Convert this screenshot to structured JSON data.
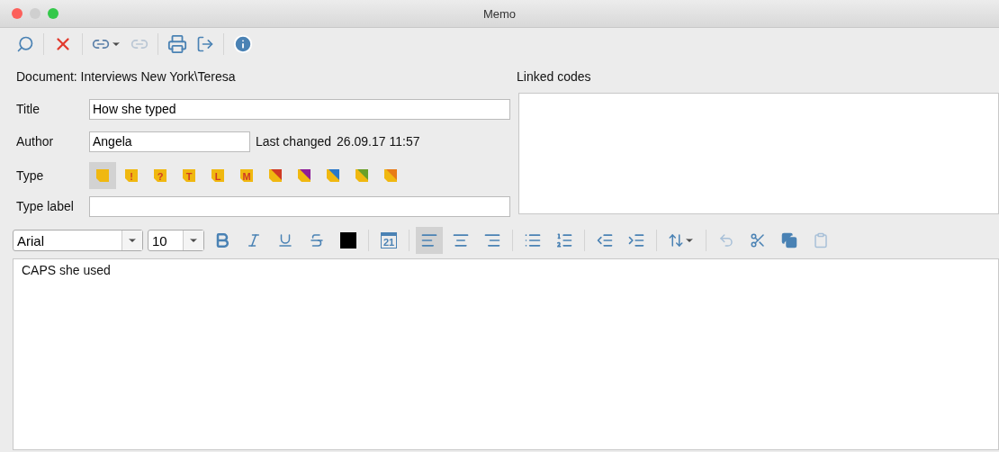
{
  "window": {
    "title": "Memo"
  },
  "document": {
    "label": "Document:",
    "value": "Interviews New York\\Teresa"
  },
  "linked_codes": {
    "label": "Linked codes"
  },
  "fields": {
    "title_label": "Title",
    "title_value": "How she typed",
    "author_label": "Author",
    "author_value": "Angela",
    "last_changed_label": "Last changed",
    "last_changed_value": "26.09.17 11:57",
    "type_label": "Type",
    "type_label_label": "Type label"
  },
  "types": [
    {
      "kind": "plain",
      "selected": true
    },
    {
      "kind": "letter",
      "glyph": "!",
      "selected": false
    },
    {
      "kind": "letter",
      "glyph": "?",
      "selected": false
    },
    {
      "kind": "letter",
      "glyph": "T",
      "selected": false
    },
    {
      "kind": "letter",
      "glyph": "L",
      "selected": false
    },
    {
      "kind": "letter",
      "glyph": "M",
      "selected": false
    },
    {
      "kind": "diagonal",
      "color": "#d03a24",
      "selected": false
    },
    {
      "kind": "diagonal",
      "color": "#8e1e99",
      "selected": false
    },
    {
      "kind": "diagonal",
      "color": "#2a78c8",
      "selected": false
    },
    {
      "kind": "diagonal",
      "color": "#6aa02a",
      "selected": false
    },
    {
      "kind": "diagonal",
      "color": "#e87c18",
      "selected": false
    }
  ],
  "format": {
    "font": "Arial",
    "size": "10",
    "calendar_day": "21",
    "align": [
      {
        "selected": true
      },
      {
        "selected": false
      },
      {
        "selected": false
      }
    ]
  },
  "editor": {
    "text": "CAPS she used"
  }
}
